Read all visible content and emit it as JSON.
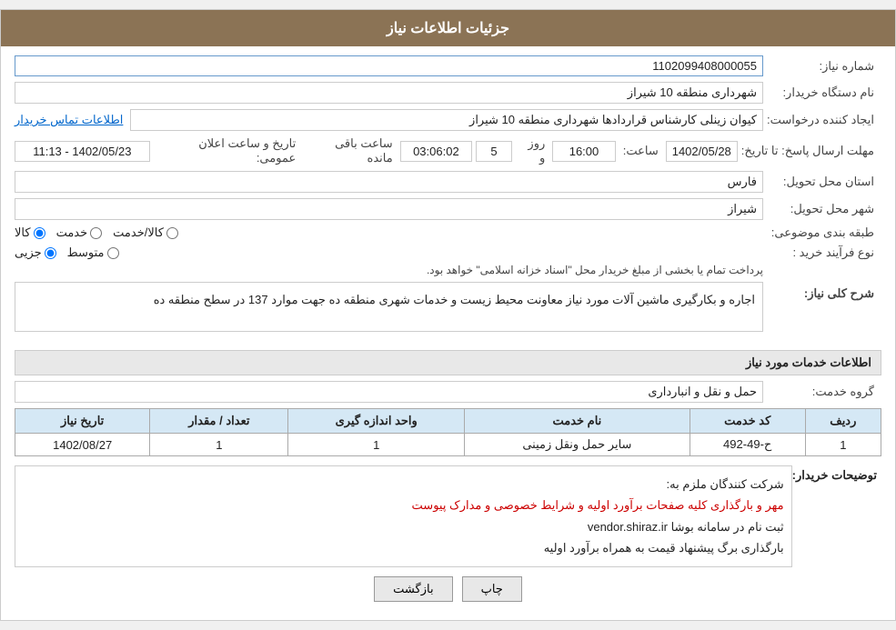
{
  "header": {
    "title": "جزئیات اطلاعات نیاز"
  },
  "fields": {
    "need_number_label": "شماره نیاز:",
    "need_number_value": "1102099408000055",
    "buyer_org_label": "نام دستگاه خریدار:",
    "buyer_org_value": "شهرداری منطقه 10 شیراز",
    "creator_label": "ایجاد کننده درخواست:",
    "creator_value": "کیوان زینلی کارشناس قراردادها شهرداری منطقه 10 شیراز",
    "creator_link": "اطلاعات تماس خریدار",
    "response_deadline_label": "مهلت ارسال پاسخ: تا تاریخ:",
    "announce_date_label": "تاریخ و ساعت اعلان عمومی:",
    "announce_date_value": "1402/05/23 - 11:13",
    "date_value": "1402/05/28",
    "time_label": "ساعت:",
    "time_value": "16:00",
    "day_label": "روز و",
    "day_value": "5",
    "remaining_label": "ساعت باقی مانده",
    "remaining_value": "03:06:02",
    "province_label": "استان محل تحویل:",
    "province_value": "فارس",
    "city_label": "شهر محل تحویل:",
    "city_value": "شیراز",
    "category_label": "طبقه بندی موضوعی:",
    "category_options": [
      "کالا",
      "خدمت",
      "کالا/خدمت"
    ],
    "category_selected": "کالا",
    "purchase_type_label": "نوع فرآیند خرید :",
    "purchase_type_options": [
      "جزیی",
      "متوسط"
    ],
    "purchase_type_note": "پرداخت تمام یا بخشی از مبلغ خریدار محل \"اسناد خزانه اسلامی\" خواهد بود.",
    "description_section": "شرح کلی نیاز:",
    "description_value": "اجاره و بکارگیری ماشین آلات مورد نیاز معاونت محیط زیست و خدمات شهری منطقه ده جهت موارد 137 در سطح منطقه ده",
    "services_section": "اطلاعات خدمات مورد نیاز",
    "service_group_label": "گروه خدمت:",
    "service_group_value": "حمل و نقل و انبارداری",
    "table": {
      "headers": [
        "ردیف",
        "کد خدمت",
        "نام خدمت",
        "واحد اندازه گیری",
        "تعداد / مقدار",
        "تاریخ نیاز"
      ],
      "rows": [
        [
          "1",
          "ح-49-492",
          "سایر حمل ونقل زمینی",
          "1",
          "1",
          "1402/08/27"
        ]
      ]
    },
    "buyer_notes_label": "توضیحات خریدار:",
    "buyer_notes_lines": [
      "شرکت کنندگان ملزم به:",
      "مهر و بارگذاری کلیه صفحات برآورد اولیه و شرایط خصوصی و مدارک پیوست",
      "ثبت نام در سامانه بوشا vendor.shiraz.ir",
      "بارگذاری برگ پیشنهاد قیمت به همراه برآورد اولیه"
    ],
    "buyer_notes_red": "مهر و بارگذاری کلیه صفحات برآورد اولیه و شرایط خصوصی و مدارک پیوست",
    "btn_back": "بازگشت",
    "btn_print": "چاپ"
  }
}
